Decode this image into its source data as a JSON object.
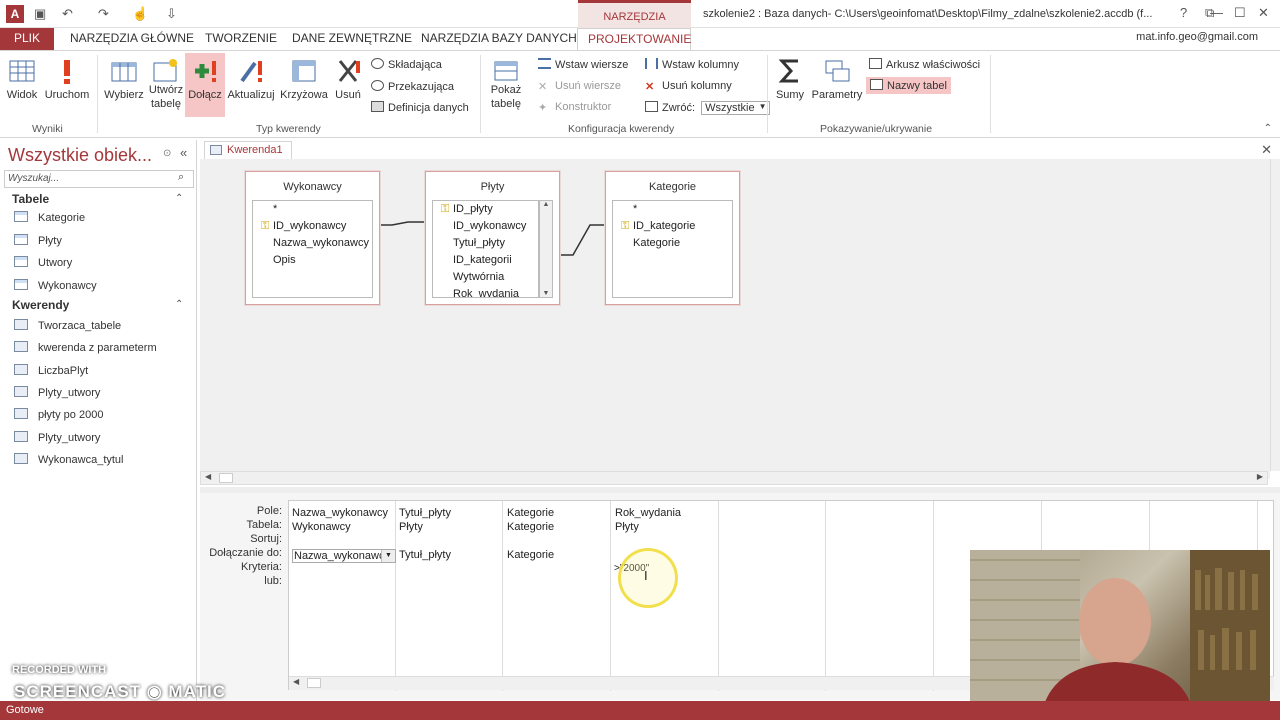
{
  "titlebar": {
    "app_icon": "A",
    "undo": "↶",
    "save": "💾",
    "context_tab": "NARZĘDZIA KWERENDY",
    "title": "szkolenie2 : Baza danych- C:\\Users\\geoinfomat\\Desktop\\Filmy_zdalne\\szkolenie2.accdb (f...",
    "help": "?",
    "minimize": "—",
    "maximize": "☐",
    "close": "✕"
  },
  "tabs": {
    "plik": "PLIK",
    "narzedzia": "NARZĘDZIA GŁÓWNE",
    "tworzenie": "TWORZENIE",
    "dane": "DANE ZEWNĘTRZNE",
    "baza": "NARZĘDZIA BAZY DANYCH",
    "projektowanie": "PROJEKTOWANIE",
    "account": "mat.info.geo@gmail.com"
  },
  "ribbon": {
    "widok": "Widok",
    "uruchom": "Uruchom",
    "wyniki": "Wyniki",
    "wybierz": "Wybierz",
    "utworz1": "Utwórz",
    "utworz2": "tabelę",
    "dolacz": "Dołącz",
    "aktualizuj": "Aktualizuj",
    "krzyzowa": "Krzyżowa",
    "usun": "Usuń",
    "skladajaca": "Składająca",
    "przekazujaca": "Przekazująca",
    "definicja": "Definicja danych",
    "typ": "Typ kwerendy",
    "pokaz1": "Pokaż",
    "pokaz2": "tabelę",
    "wstaw_wiersze": "Wstaw wiersze",
    "usun_wiersze": "Usuń wiersze",
    "konstruktor": "Konstruktor",
    "wstaw_kolumny": "Wstaw kolumny",
    "usun_kolumny": "Usuń kolumny",
    "zwroc": "Zwróć:",
    "zwroc_val": "Wszystkie",
    "konfig": "Konfiguracja kwerendy",
    "sumy": "Sumy",
    "parametry": "Parametry",
    "arkusz": "Arkusz właściwości",
    "nazwy": "Nazwy tabel",
    "pokazywanie": "Pokazywanie/ukrywanie"
  },
  "nav": {
    "title": "Wszystkie obiek...",
    "search_placeholder": "Wyszukaj...",
    "tabele_label": "Tabele",
    "tabele": [
      "Kategorie",
      "Płyty",
      "Utwory",
      "Wykonawcy"
    ],
    "kwerendy_label": "Kwerendy",
    "kwerendy": [
      "Tworzaca_tabele",
      "kwerenda z parameterm",
      "LiczbaPlyt",
      "Plyty_utwory",
      "płyty po 2000",
      "Plyty_utwory",
      "Wykonawca_tytul"
    ]
  },
  "doc": {
    "tab": "Kwerenda1"
  },
  "tables": [
    {
      "name": "Wykonawcy",
      "fields": [
        "*",
        "ID_wykonawcy",
        "Nazwa_wykonawcy",
        "Opis"
      ],
      "key": 1
    },
    {
      "name": "Płyty",
      "fields": [
        "ID_płyty",
        "ID_wykonawcy",
        "Tytuł_płyty",
        "ID_kategorii",
        "Wytwórnia",
        "Rok_wydania"
      ],
      "key": 0
    },
    {
      "name": "Kategorie",
      "fields": [
        "*",
        "ID_kategorie",
        "Kategorie"
      ],
      "key": 1
    }
  ],
  "grid": {
    "labels": [
      "Pole:",
      "Tabela:",
      "Sortuj:",
      "Dołączanie do:",
      "Kryteria:",
      "lub:"
    ],
    "cols": [
      {
        "pole": "Nazwa_wykonawcy",
        "tabela": "Wykonawcy",
        "dolacz": "Nazwa_wykonawc"
      },
      {
        "pole": "Tytuł_płyty",
        "tabela": "Płyty",
        "dolacz": "Tytuł_płyty"
      },
      {
        "pole": "Kategorie",
        "tabela": "Kategorie",
        "dolacz": "Kategorie"
      },
      {
        "pole": "Rok_wydania",
        "tabela": "Płyty",
        "dolacz": ""
      }
    ],
    "criteria": ">\"2000\""
  },
  "watermark": {
    "line1": "RECORDED WITH",
    "line2": "SCREENCAST ◉ MATIC"
  },
  "status": "Gotowe"
}
